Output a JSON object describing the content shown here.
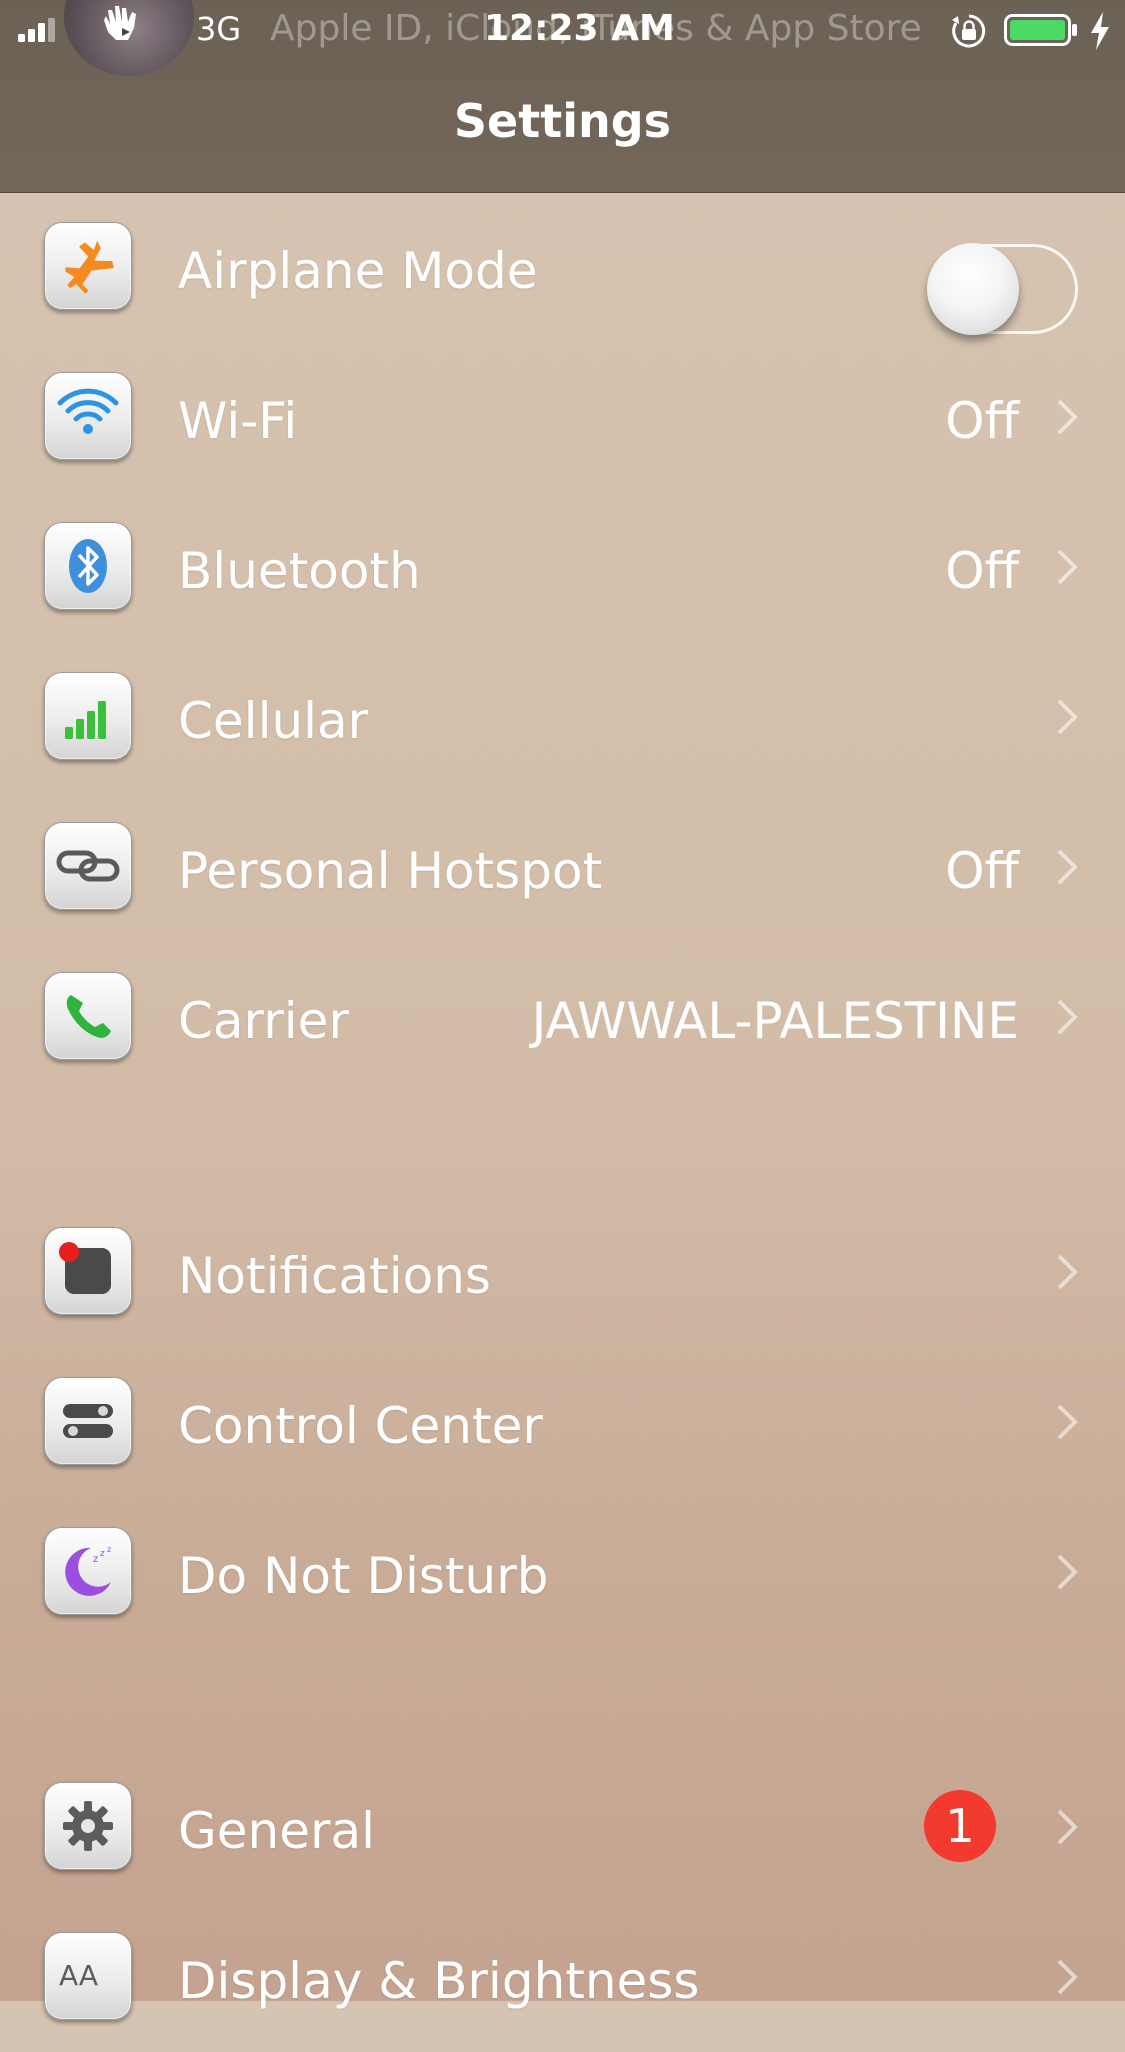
{
  "status_bar": {
    "network_type": "3G",
    "banner": "Apple ID, iCloud, iTunes & App Store",
    "time": "12:23 AM"
  },
  "nav": {
    "title": "Settings"
  },
  "rows": {
    "airplane": {
      "label": "Airplane Mode",
      "toggle_on": false
    },
    "wifi": {
      "label": "Wi-Fi",
      "value": "Off"
    },
    "bluetooth": {
      "label": "Bluetooth",
      "value": "Off"
    },
    "cellular": {
      "label": "Cellular"
    },
    "hotspot": {
      "label": "Personal Hotspot",
      "value": "Off"
    },
    "carrier": {
      "label": "Carrier",
      "value": "JAWWAL-PALESTINE"
    },
    "notifications": {
      "label": "Notifications"
    },
    "control_center": {
      "label": "Control Center"
    },
    "dnd": {
      "label": "Do Not Disturb"
    },
    "general": {
      "label": "General",
      "badge": "1"
    },
    "display": {
      "label": "Display & Brightness"
    }
  },
  "colors": {
    "header": "#6f6458",
    "background": "#d4c0ac",
    "badge": "#f23a2e",
    "battery_fill": "#4cd964"
  }
}
